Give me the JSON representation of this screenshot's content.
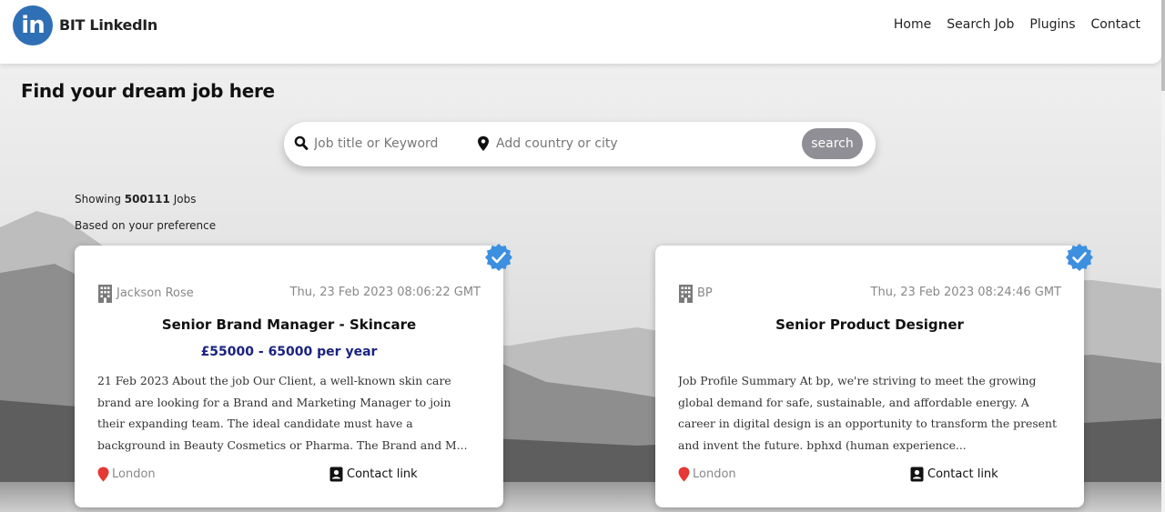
{
  "app": {
    "logo_text": "in",
    "brand": "BIT LinkedIn"
  },
  "nav": {
    "items": [
      "Home",
      "Search Job",
      "Plugins",
      "Contact"
    ]
  },
  "page": {
    "title": "Find your dream job here"
  },
  "search": {
    "keyword_placeholder": "Job title or Keyword",
    "location_placeholder": "Add country or city",
    "button_label": "search"
  },
  "results": {
    "showing_prefix": "Showing",
    "count": "500111",
    "showing_suffix": "Jobs",
    "preference_note": "Based on your preference"
  },
  "colors": {
    "brand": "#2f6fb5",
    "verified_badge": "#3d8fe0",
    "salary": "#1a237e",
    "location_pin": "#e53935",
    "search_button": "#8f8f95"
  },
  "icons": {
    "search": "search-icon",
    "location": "map-pin-icon",
    "company": "building-icon",
    "verified": "verified-badge-icon",
    "contact": "contact-card-icon"
  },
  "jobs": [
    {
      "company": "Jackson Rose",
      "date": "Thu, 23 Feb 2023 08:06:22 GMT",
      "title": "Senior Brand Manager - Skincare",
      "salary": "£55000 - 65000 per year",
      "description": "21 Feb 2023 About the job Our Client, a well-known skin care brand are looking for a Brand and Marketing Manager to join their expanding team. The ideal candidate must have a background in Beauty Cosmetics or Pharma. The Brand and M...",
      "location": "London",
      "contact_label": "Contact link"
    },
    {
      "company": "BP",
      "date": "Thu, 23 Feb 2023 08:24:46 GMT",
      "title": "Senior Product Designer",
      "salary": "",
      "description": "Job Profile Summary At bp, we're striving to meet the growing global demand for safe, sustainable, and affordable energy. A career in digital design is an opportunity to transform the present and invent the future. bphxd (human experience...",
      "location": "London",
      "contact_label": "Contact link"
    }
  ]
}
